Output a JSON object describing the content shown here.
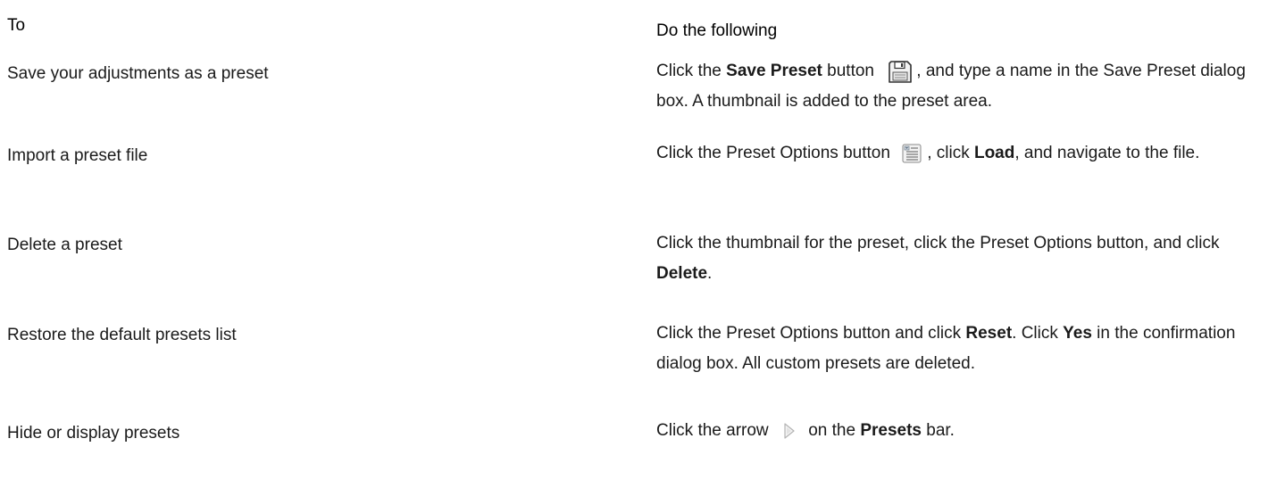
{
  "header": {
    "col_to": "To",
    "col_do": "Do the following"
  },
  "rows": [
    {
      "to": "Save your adjustments as a preset",
      "do_parts": {
        "a": "Click the ",
        "b": "Save Preset",
        "c": " button ",
        "d": ", and type a name in the Save Preset dialog box. A thumbnail is added to the preset area."
      },
      "icon": "save-preset-icon"
    },
    {
      "to": "Import a preset file",
      "do_parts": {
        "a": "Click the Preset Options button ",
        "b": ", click ",
        "c": "Load",
        "d": ", and navigate to the file."
      },
      "icon": "preset-options-icon"
    },
    {
      "to": "Delete a preset",
      "do_parts": {
        "a": "Click the thumbnail for the preset, click the Preset Options button, and click ",
        "b": "Delete",
        "c": "."
      }
    },
    {
      "to": "Restore the default presets list",
      "do_parts": {
        "a": "Click the Preset Options button and click ",
        "b": "Reset",
        "c": ". Click ",
        "d": "Yes",
        "e": " in the confirmation dialog box. All custom presets are deleted."
      }
    },
    {
      "to": "Hide or display presets",
      "do_parts": {
        "a": "Click the arrow ",
        "b": " on the ",
        "c": "Presets",
        "d": " bar."
      },
      "icon": "arrow-icon"
    }
  ]
}
